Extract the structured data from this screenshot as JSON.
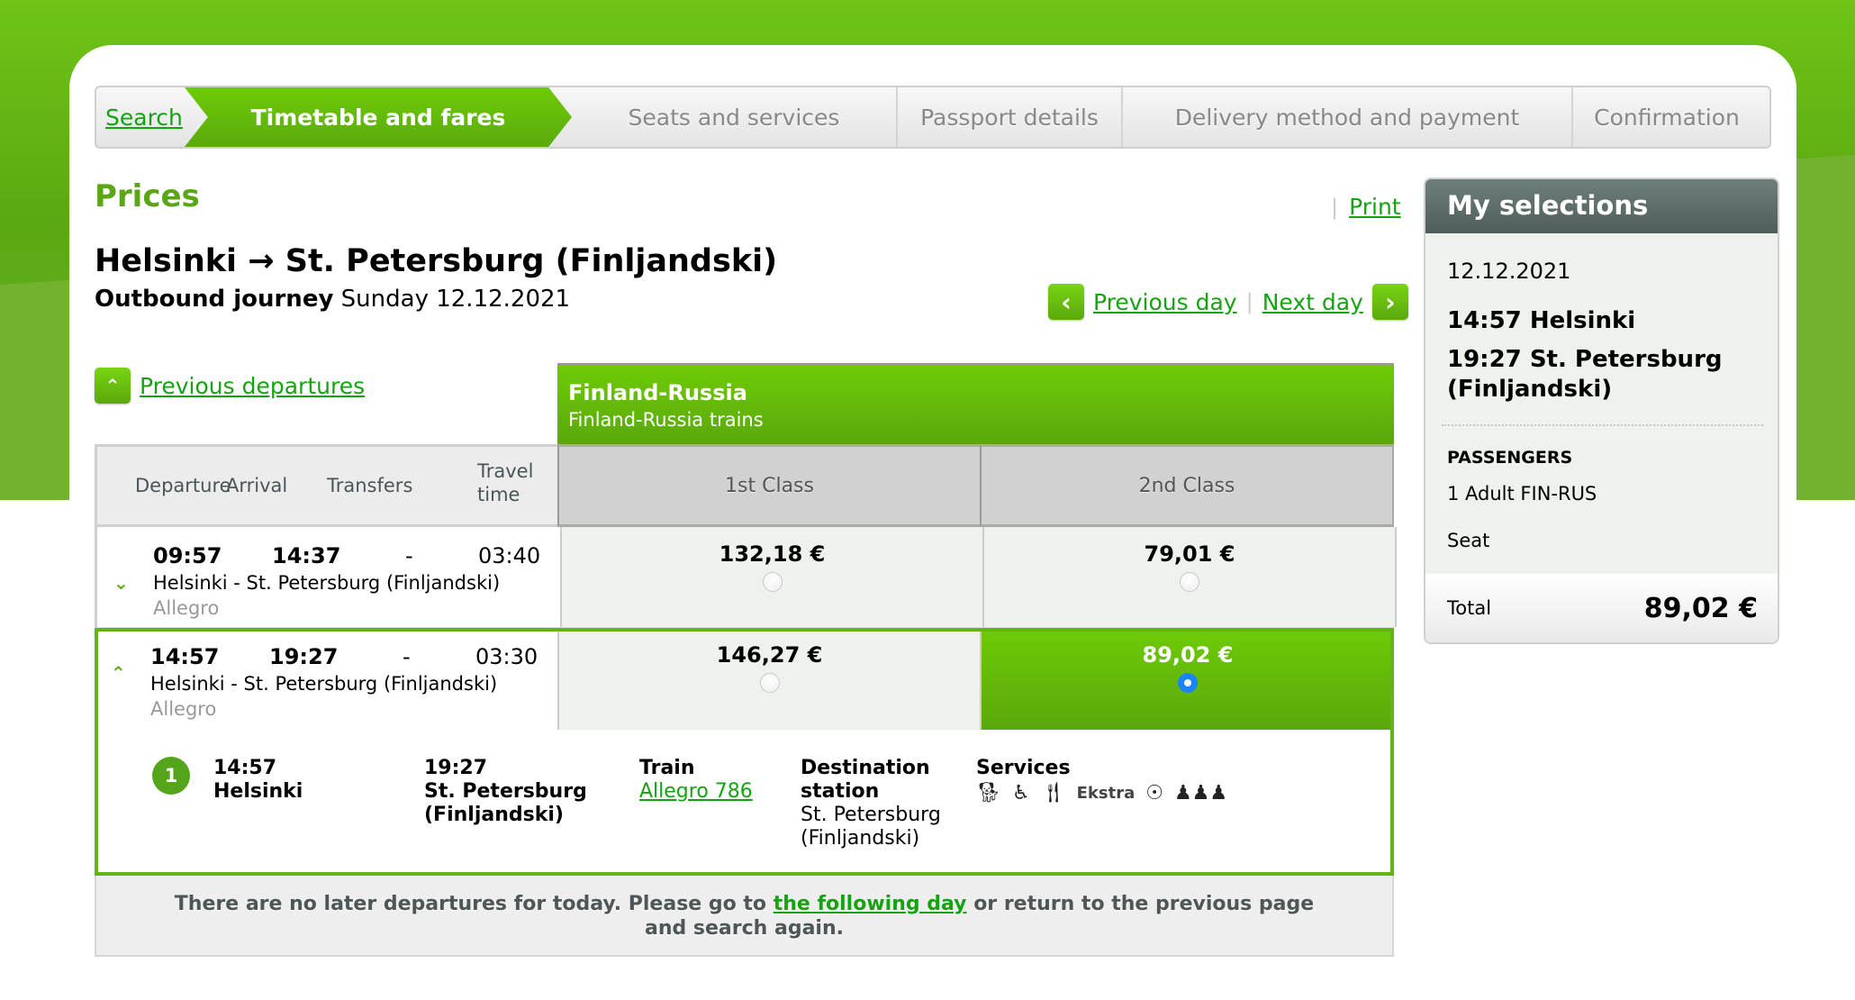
{
  "steps": [
    {
      "label": "Search",
      "state": "link"
    },
    {
      "label": "Timetable and fares",
      "state": "active"
    },
    {
      "label": "Seats and services",
      "state": "disabled"
    },
    {
      "label": "Passport details",
      "state": "disabled"
    },
    {
      "label": "Delivery method and payment",
      "state": "disabled"
    },
    {
      "label": "Confirmation",
      "state": "disabled"
    }
  ],
  "page": {
    "section_title": "Prices",
    "route_title": "Helsinki → St. Petersburg (Finljandski)",
    "journey_label": "Outbound journey",
    "journey_date": "Sunday 12.12.2021",
    "print_label": "Print",
    "prev_day_label": "Previous day",
    "next_day_label": "Next day",
    "prev_departures_label": "Previous departures"
  },
  "table": {
    "group_title": "Finland-Russia",
    "group_subtitle": "Finland-Russia trains",
    "columns": [
      "Departure",
      "Arrival",
      "Transfers",
      "Travel",
      "time"
    ],
    "classes": [
      "1st Class",
      "2nd Class"
    ],
    "rows": [
      {
        "departure": "09:57",
        "arrival": "14:37",
        "transfers": "-",
        "travel_time": "03:40",
        "route": "Helsinki - St. Petersburg (Finljandski)",
        "train": "Allegro",
        "fares": [
          "132,18 €",
          "79,01 €"
        ],
        "selected_fare": null,
        "expanded": false
      },
      {
        "departure": "14:57",
        "arrival": "19:27",
        "transfers": "-",
        "travel_time": "03:30",
        "route": "Helsinki - St. Petersburg (Finljandski)",
        "train": "Allegro",
        "fares": [
          "146,27 €",
          "89,02 €"
        ],
        "selected_fare": 1,
        "expanded": true
      }
    ],
    "detail": {
      "leg_number": "1",
      "dep_time": "14:57",
      "dep_station": "Helsinki",
      "arr_time": "19:27",
      "arr_station_1": "St. Petersburg",
      "arr_station_2": "(Finljandski)",
      "train_label": "Train",
      "train_link": "Allegro 786",
      "dest_label_1": "Destination",
      "dest_label_2": "station",
      "dest_value_1": "St. Petersburg",
      "dest_value_2": "(Finljandski)",
      "services_label": "Services",
      "services": [
        "pet-icon",
        "wheelchair-icon",
        "restaurant-icon",
        "Ekstra",
        "child-icon",
        "family-compartment-icon"
      ],
      "ekstra_label": "Ekstra"
    },
    "notice_before": "There are no later departures for today. Please go to ",
    "notice_link": "the following day",
    "notice_after": " or return to the previous page and search again."
  },
  "sidebar": {
    "title": "My selections",
    "date": "12.12.2021",
    "departure": "14:57 Helsinki",
    "arrival": "19:27 St. Petersburg (Finljandski)",
    "passengers_label": "PASSENGERS",
    "passenger": "1 Adult FIN-RUS",
    "seat": "Seat",
    "total_label": "Total",
    "total_value": "89,02 €"
  },
  "colors": {
    "brand_green": "#5ba617",
    "link_green": "#16a312",
    "selected_radio": "#1a84ff"
  }
}
